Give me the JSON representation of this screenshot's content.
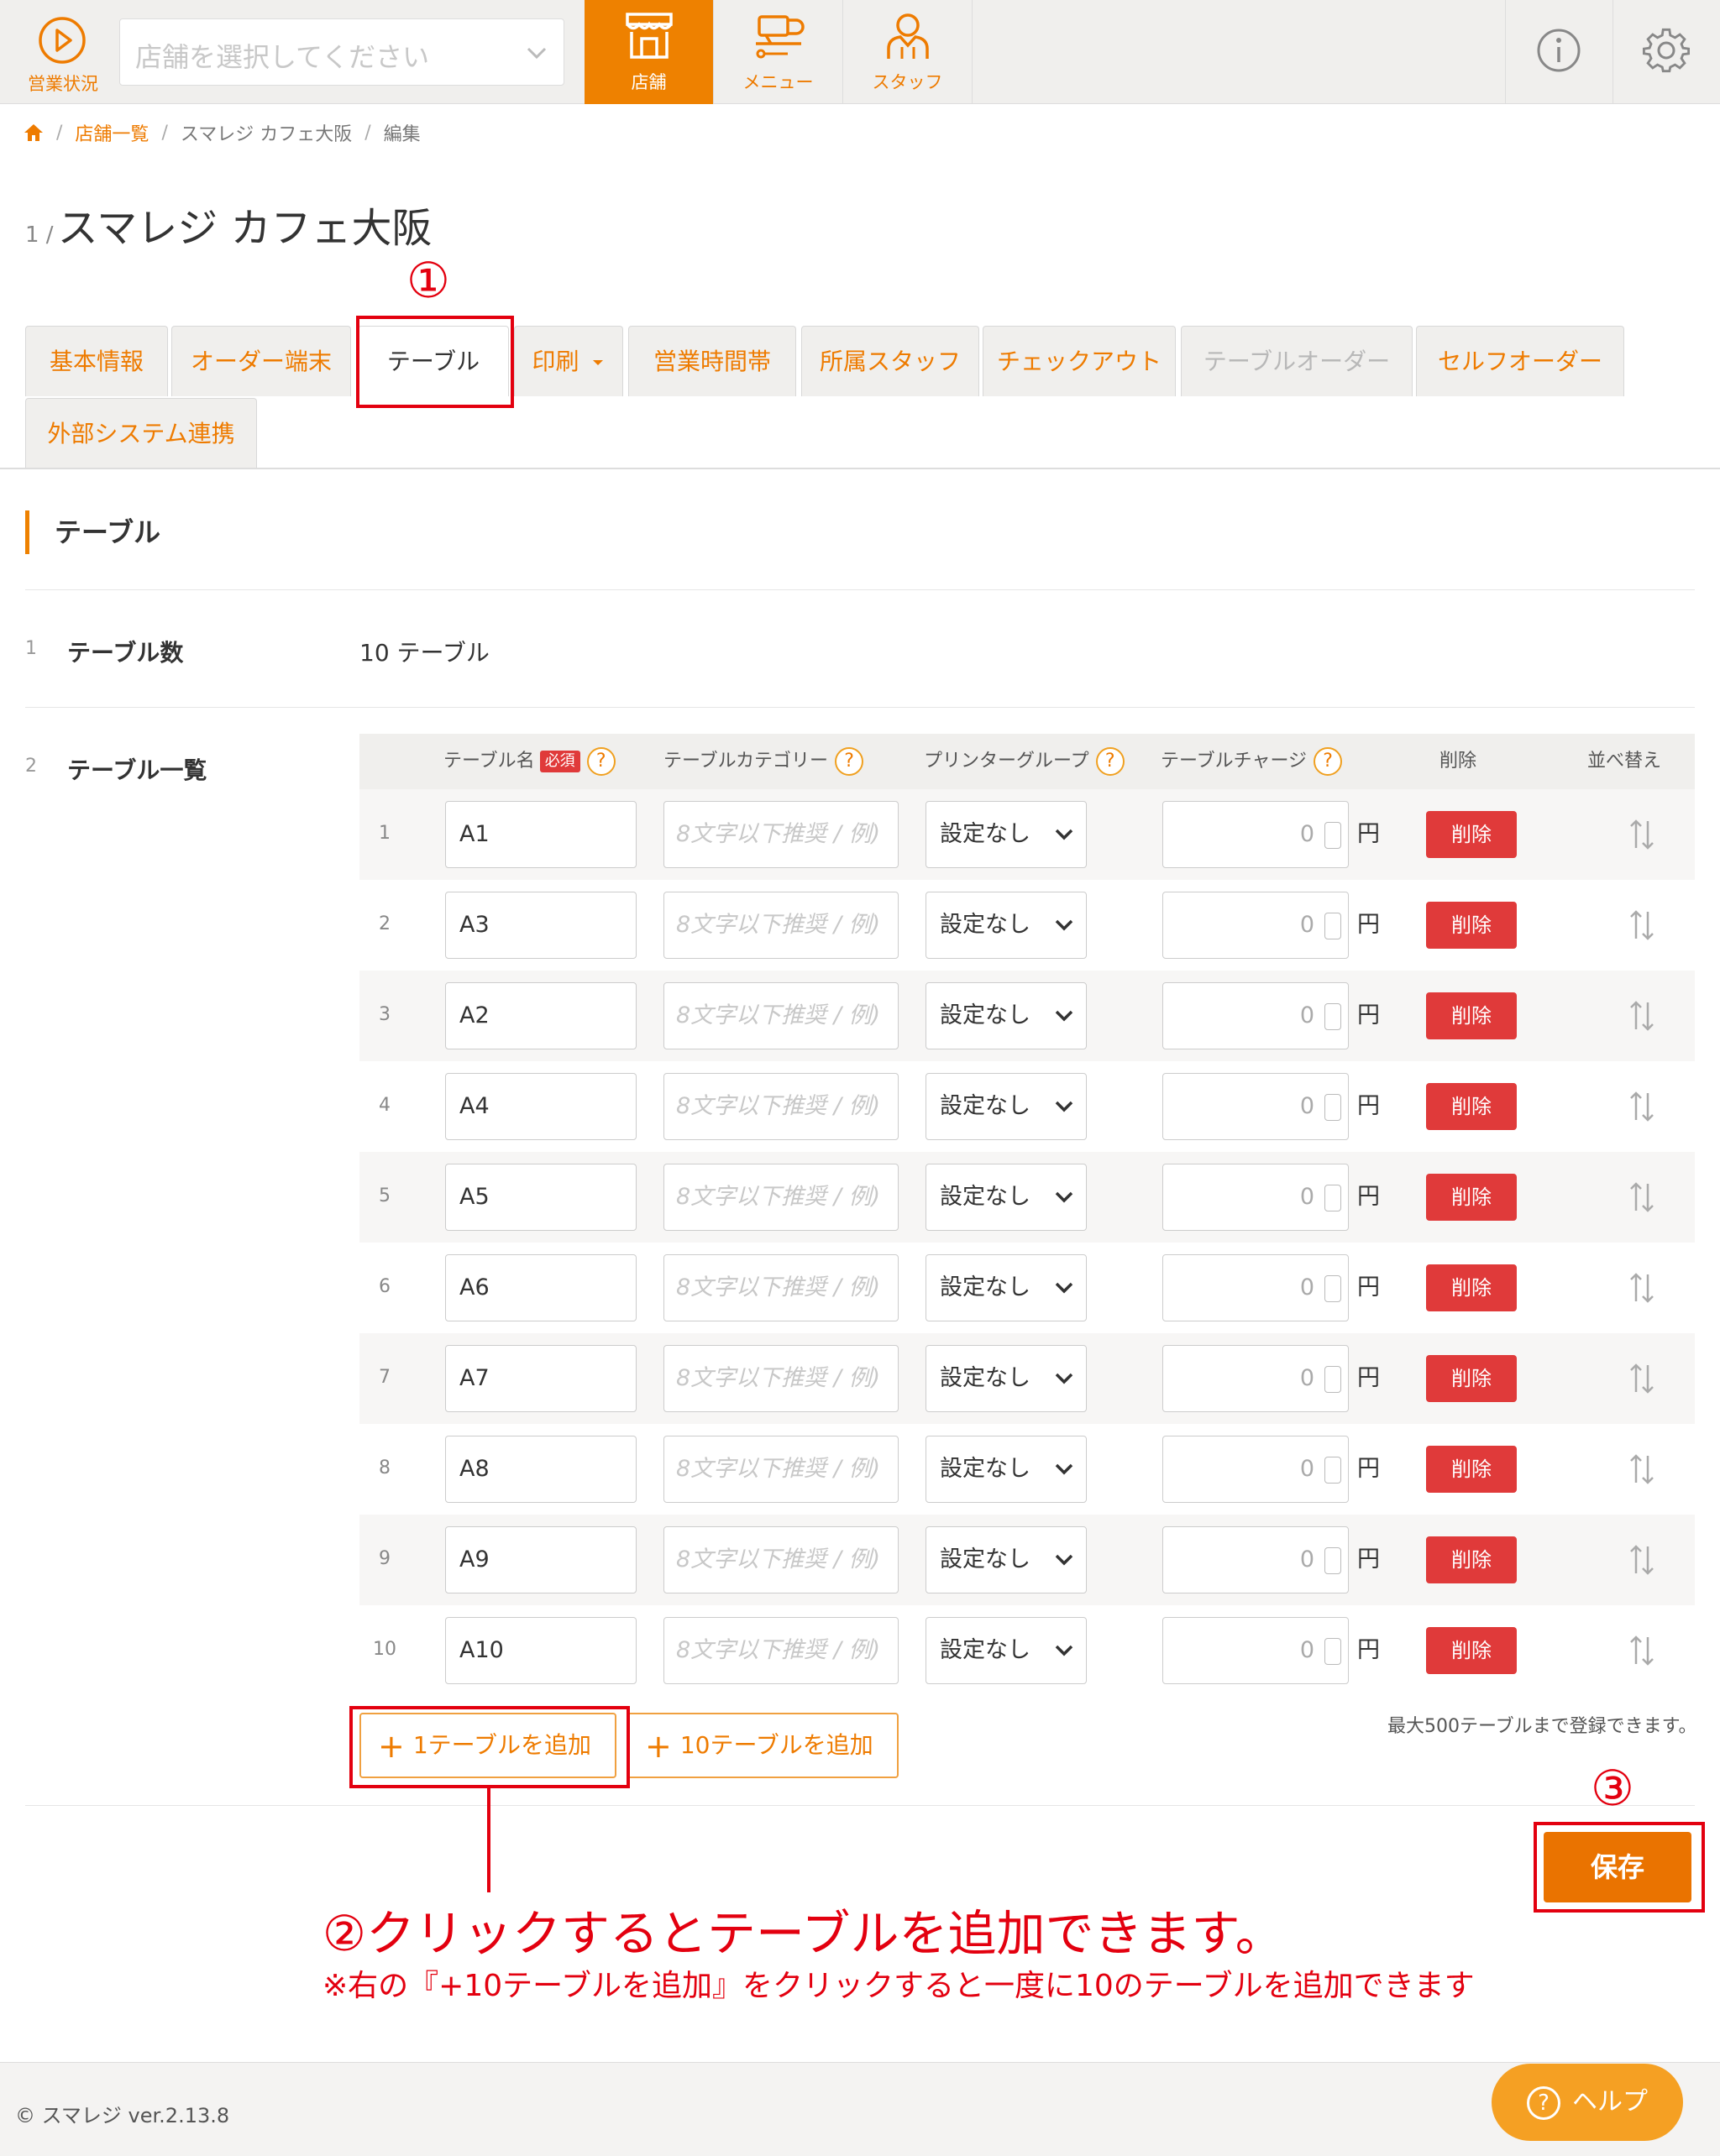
{
  "header": {
    "status_label": "営業状況",
    "store_select_placeholder": "店舗を選択してください",
    "nav": [
      {
        "label": "店舗",
        "active": true
      },
      {
        "label": "メニュー",
        "active": false
      },
      {
        "label": "スタッフ",
        "active": false
      }
    ],
    "accent_color": "#ee8100"
  },
  "breadcrumb": [
    "店舗一覧",
    "スマレジ カフェ大阪",
    "編集"
  ],
  "page": {
    "number": "1 /",
    "store_name": "スマレジ カフェ大阪"
  },
  "store_tabs": [
    {
      "label": "基本情報",
      "state": "normal"
    },
    {
      "label": "オーダー端末",
      "state": "normal"
    },
    {
      "label": "テーブル",
      "state": "active"
    },
    {
      "label": "印刷",
      "state": "normal"
    },
    {
      "label": "営業時間帯",
      "state": "normal"
    },
    {
      "label": "所属スタッフ",
      "state": "normal"
    },
    {
      "label": "チェックアウト",
      "state": "normal"
    },
    {
      "label": "テーブルオーダー",
      "state": "disabled"
    },
    {
      "label": "セルフオーダー",
      "state": "normal"
    },
    {
      "label": "外部システム連携",
      "state": "normal"
    }
  ],
  "section": {
    "title": "テーブル",
    "rows": [
      {
        "num": "1",
        "label": "テーブル数",
        "value": "10 テーブル"
      },
      {
        "num": "2",
        "label": "テーブル一覧"
      }
    ]
  },
  "table": {
    "headers": {
      "name": "テーブル名",
      "required": "必須",
      "category": "テーブルカテゴリー",
      "printer": "プリンターグループ",
      "charge": "テーブルチャージ",
      "delete": "削除",
      "sort": "並べ替え"
    },
    "category_placeholder": "8文字以下推奨 / 例)",
    "printer_value": "設定なし",
    "charge_value": "0",
    "currency": "円",
    "delete_label": "削除",
    "rows": [
      {
        "idx": "1",
        "name": "A1"
      },
      {
        "idx": "2",
        "name": "A3"
      },
      {
        "idx": "3",
        "name": "A2"
      },
      {
        "idx": "4",
        "name": "A4"
      },
      {
        "idx": "5",
        "name": "A5"
      },
      {
        "idx": "6",
        "name": "A6"
      },
      {
        "idx": "7",
        "name": "A7"
      },
      {
        "idx": "8",
        "name": "A8"
      },
      {
        "idx": "9",
        "name": "A9"
      },
      {
        "idx": "10",
        "name": "A10"
      }
    ]
  },
  "actions": {
    "add_one": "1テーブルを追加",
    "add_ten": "10テーブルを追加",
    "max_note": "最大500テーブルまで登録できます。",
    "save": "保存"
  },
  "annotations": {
    "step1": "①",
    "step2": "②クリックするとテーブルを追加できます。",
    "step2_note": "※右の『+10テーブルを追加』をクリックすると一度に10のテーブルを追加できます",
    "step3": "③",
    "color": "#e3000f"
  },
  "footer": {
    "copyright": "© スマレジ ver.2.13.8",
    "help": "ヘルプ"
  }
}
